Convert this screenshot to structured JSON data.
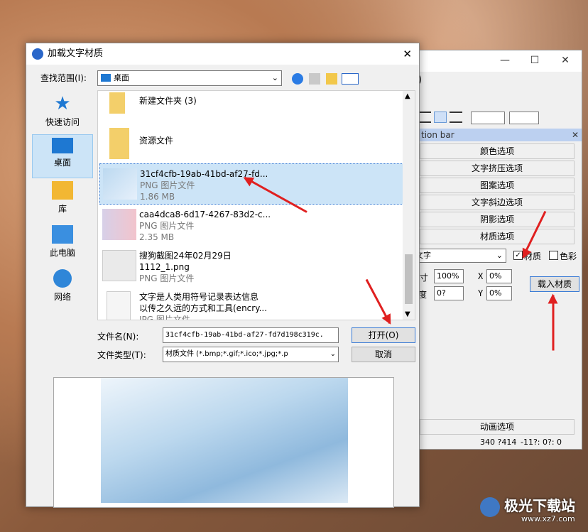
{
  "background_app": {
    "tabs": [
      "颜色选项",
      "文字挤压选项",
      "图案选项",
      "文字斜边选项",
      "阴影选项",
      "材质选项"
    ],
    "action_bar_title": "tion bar",
    "anim_tab": "动画选项",
    "status_text": "340 ?414",
    "status_text2": "-11?: 0?: 0",
    "combo_value": "文字",
    "chk_material": "材质",
    "chk_color": "色彩",
    "lbl_c": "寸",
    "lbl_d": "度",
    "val_100": "100%",
    "val_0p": "0%",
    "val_0q": "0?",
    "val_0p2": "0%",
    "x_label": "X",
    "y_label": "Y",
    "load_btn": "载入材质",
    "paren": ")"
  },
  "dialog": {
    "title": "加载文字材质",
    "lookin_label": "查找范围(I):",
    "lookin_value": "桌面",
    "places": [
      "快速访问",
      "桌面",
      "库",
      "此电脑",
      "网络"
    ],
    "files": [
      {
        "name": "新建文件夹 (3)",
        "type": "",
        "size": ""
      },
      {
        "name": "资源文件",
        "type": "",
        "size": ""
      },
      {
        "name": "31cf4cfb-19ab-41bd-af27-fd...",
        "type": "PNG 图片文件",
        "size": "1.86 MB"
      },
      {
        "name": "caa4dca8-6d17-4267-83d2-c...",
        "type": "PNG 图片文件",
        "size": "2.35 MB"
      },
      {
        "name": "搜狗截图24年02月29日",
        "name2": "1112_1.png",
        "type": "PNG 图片文件",
        "size": ""
      },
      {
        "name": "文字是人类用符号记录表达信息",
        "name2": "以传之久远的方式和工具(encry...",
        "type": "JPG 图片文件",
        "size": ""
      }
    ],
    "filename_label": "文件名(N):",
    "filename_value": "31cf4cfb-19ab-41bd-af27-fd7d198c319c.",
    "filetype_label": "文件类型(T):",
    "filetype_value": "材质文件 (*.bmp;*.gif;*.ico;*.jpg;*.p",
    "open_btn": "打开(O)",
    "cancel_btn": "取消"
  },
  "watermark": "极光下载站",
  "watermark_url": "www.xz7.com"
}
